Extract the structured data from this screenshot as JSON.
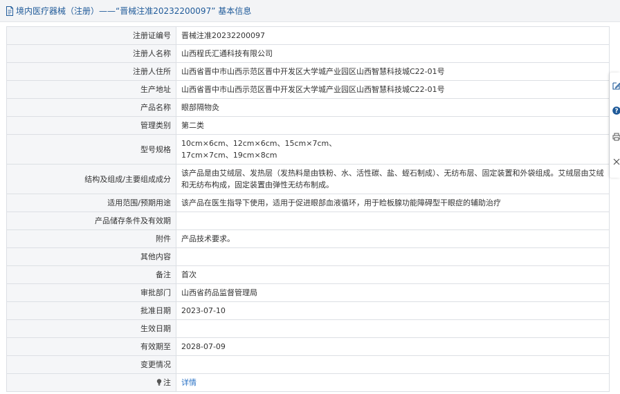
{
  "header": {
    "title": "境内医疗器械（注册）——“晋械注准20232200097” 基本信息",
    "icon": "document-icon",
    "color": "#1f5a99"
  },
  "rows": [
    {
      "label": "注册证编号",
      "value": "晋械注准20232200097"
    },
    {
      "label": "注册人名称",
      "value": "山西程氏汇通科技有限公司"
    },
    {
      "label": "注册人住所",
      "value": "山西省晋中市山西示范区晋中开发区大学城产业园区山西智慧科技城C22-01号"
    },
    {
      "label": "生产地址",
      "value": "山西省晋中市山西示范区晋中开发区大学城产业园区山西智慧科技城C22-01号"
    },
    {
      "label": "产品名称",
      "value": "眼部隔物灸"
    },
    {
      "label": "管理类别",
      "value": "第二类"
    },
    {
      "label": "型号规格",
      "value": "10cm×6cm、12cm×6cm、15cm×7cm、\n17cm×7cm、19cm×8cm"
    },
    {
      "label": "结构及组成/主要组成成分",
      "value": "该产品是由艾绒层、发热层（发热料是由铁粉、水、活性碳、盐、蛭石制成）、无纺布层、固定装置和外袋组成。艾绒层由艾绒和无纺布构成，固定装置由弹性无纺布制成。"
    },
    {
      "label": "适用范围/预期用途",
      "value": "该产品在医生指导下使用，适用于促进眼部血液循环，用于睑板腺功能障碍型干眼症的辅助治疗"
    },
    {
      "label": "产品储存条件及有效期",
      "value": ""
    },
    {
      "label": "附件",
      "value": "产品技术要求。"
    },
    {
      "label": "其他内容",
      "value": ""
    },
    {
      "label": "备注",
      "value": "首次"
    },
    {
      "label": "审批部门",
      "value": "山西省药品监督管理局"
    },
    {
      "label": "批准日期",
      "value": "2023-07-10"
    },
    {
      "label": "生效日期",
      "value": ""
    },
    {
      "label": "有效期至",
      "value": "2028-07-09"
    },
    {
      "label": "变更情况",
      "value": ""
    }
  ],
  "note": {
    "label": "注",
    "link": "详情",
    "icon": "lightbulb-icon"
  },
  "toolbar": [
    {
      "icon": "edit-icon"
    },
    {
      "icon": "help-icon"
    },
    {
      "icon": "print-icon"
    },
    {
      "icon": "close-icon"
    }
  ],
  "colors": {
    "link": "#2a72c5",
    "label_bg": "#f5f6f8",
    "border": "#dcdfe4",
    "help": "#1f5a99"
  }
}
